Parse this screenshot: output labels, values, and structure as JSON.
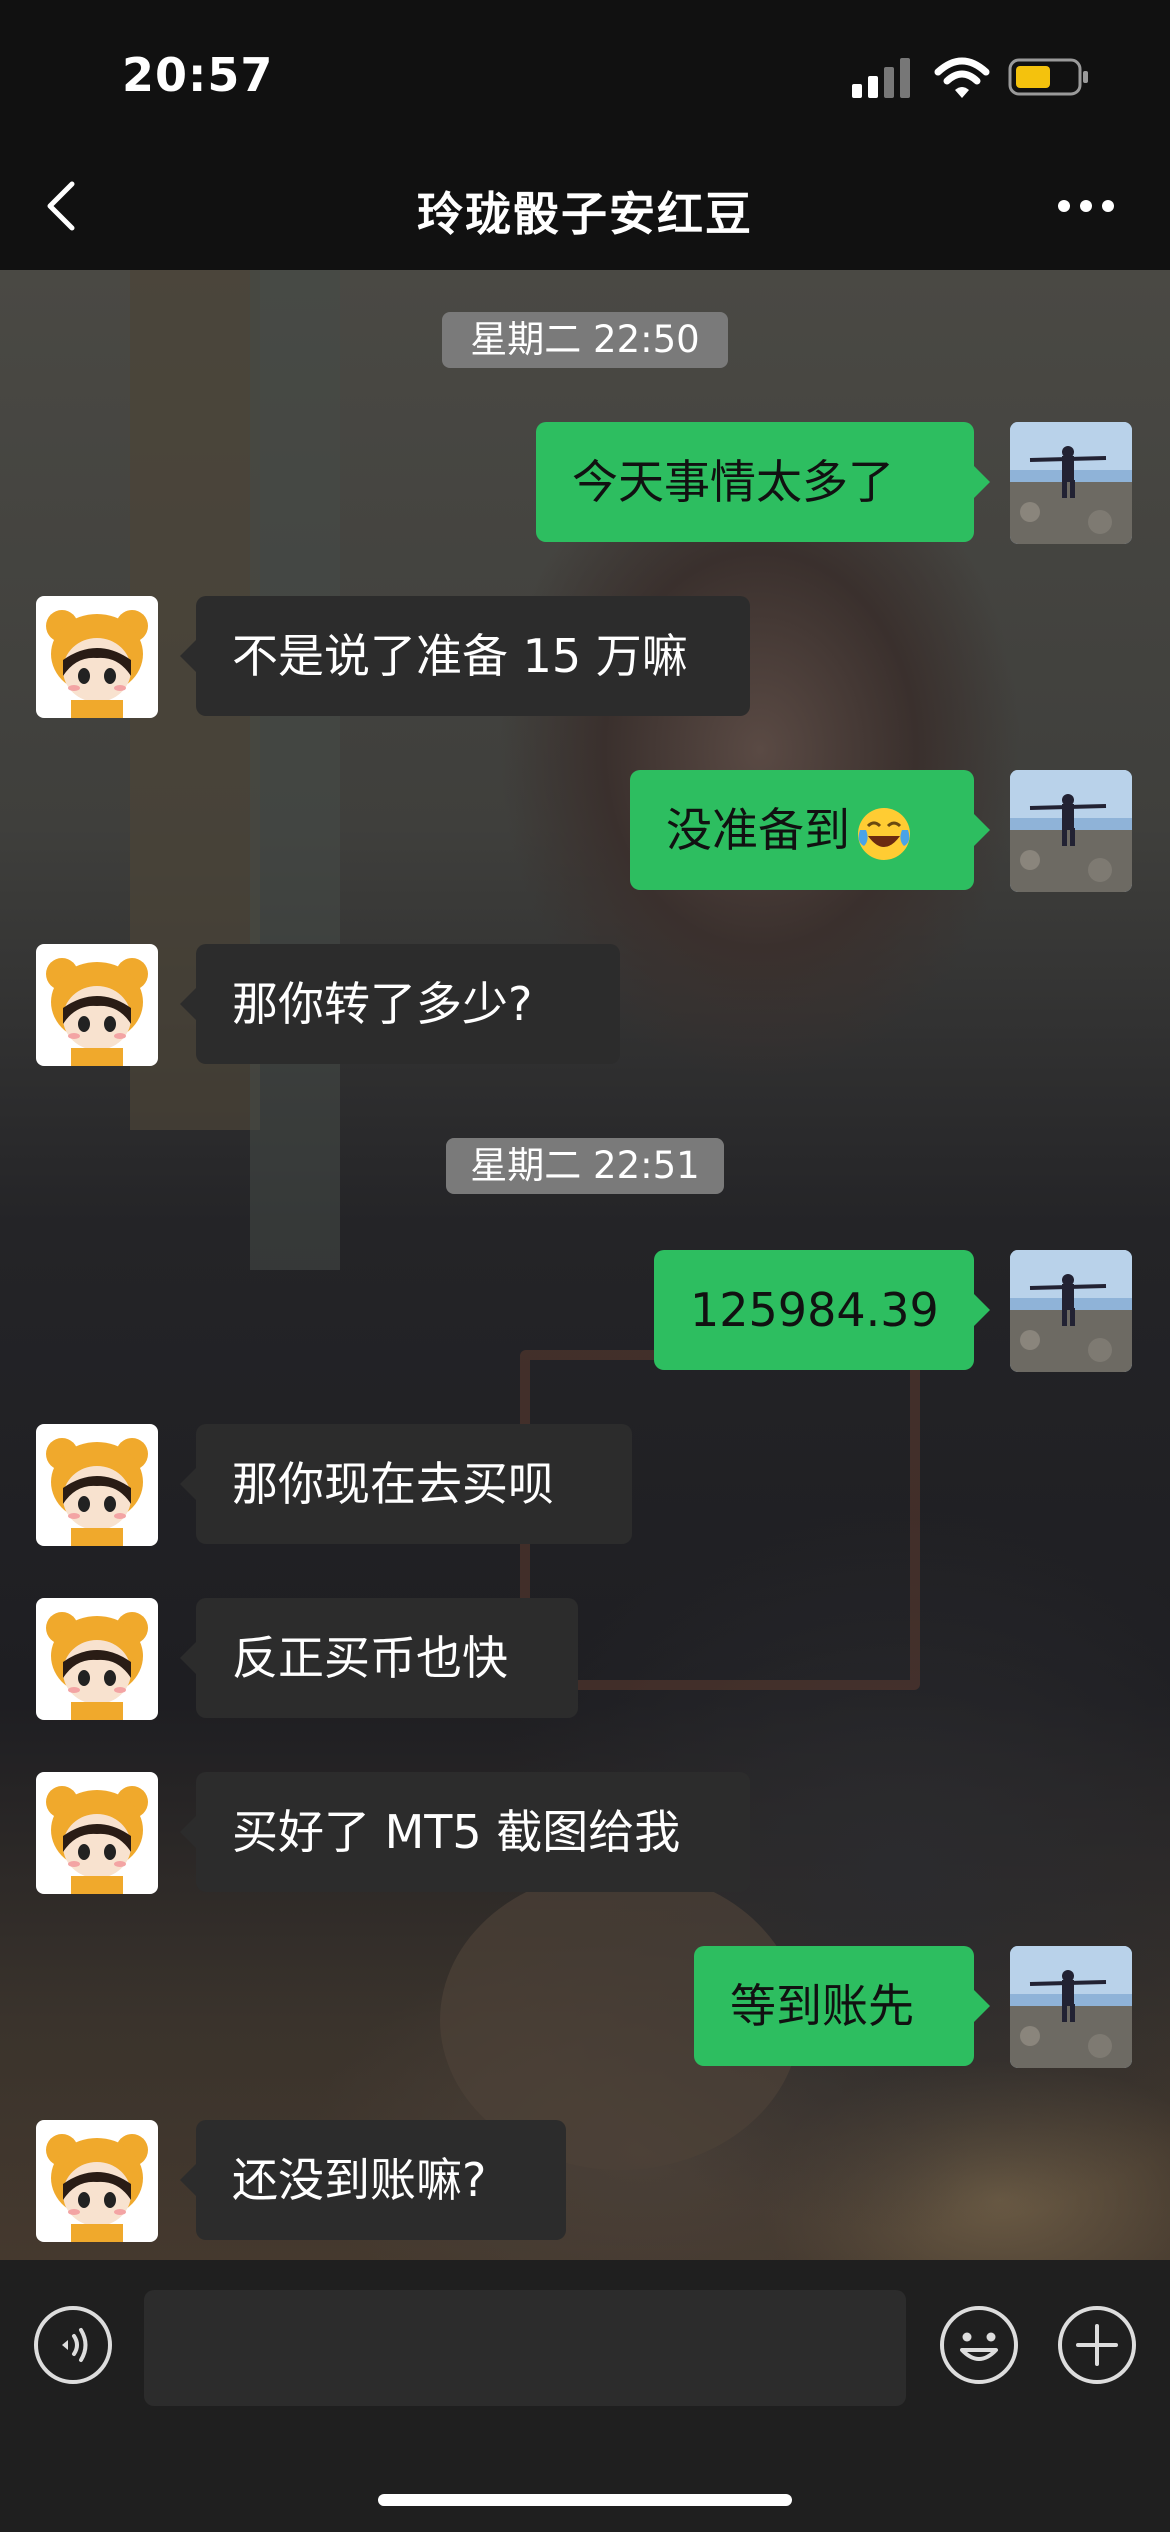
{
  "status": {
    "time": "20:57"
  },
  "nav": {
    "title": "玲珑骰子安红豆"
  },
  "timestamps": [
    "星期二 22:50",
    "星期二 22:51"
  ],
  "messages": [
    {
      "from": "me",
      "text": "今天事情太多了"
    },
    {
      "from": "them",
      "text": "不是说了准备 15 万嘛"
    },
    {
      "from": "me",
      "text": "没准备到",
      "emoji": "laughing-crying-emoji"
    },
    {
      "from": "them",
      "text": "那你转了多少?"
    },
    {
      "from": "me",
      "text": "125984.39"
    },
    {
      "from": "them",
      "text": "那你现在去买呗"
    },
    {
      "from": "them",
      "text": "反正买币也快"
    },
    {
      "from": "them",
      "text": "买好了 MT5 截图给我"
    },
    {
      "from": "me",
      "text": "等到账先"
    },
    {
      "from": "them",
      "text": "还没到账嘛?"
    }
  ],
  "input": {
    "value": ""
  },
  "colors": {
    "outgoing_bubble": "#2dbe60",
    "incoming_bubble": "#2c2c2c",
    "bar": "#111111"
  },
  "icons": [
    "back-icon",
    "more-icon",
    "signal-icon",
    "wifi-icon",
    "battery-icon",
    "voice-icon",
    "emoji-icon",
    "plus-icon"
  ]
}
